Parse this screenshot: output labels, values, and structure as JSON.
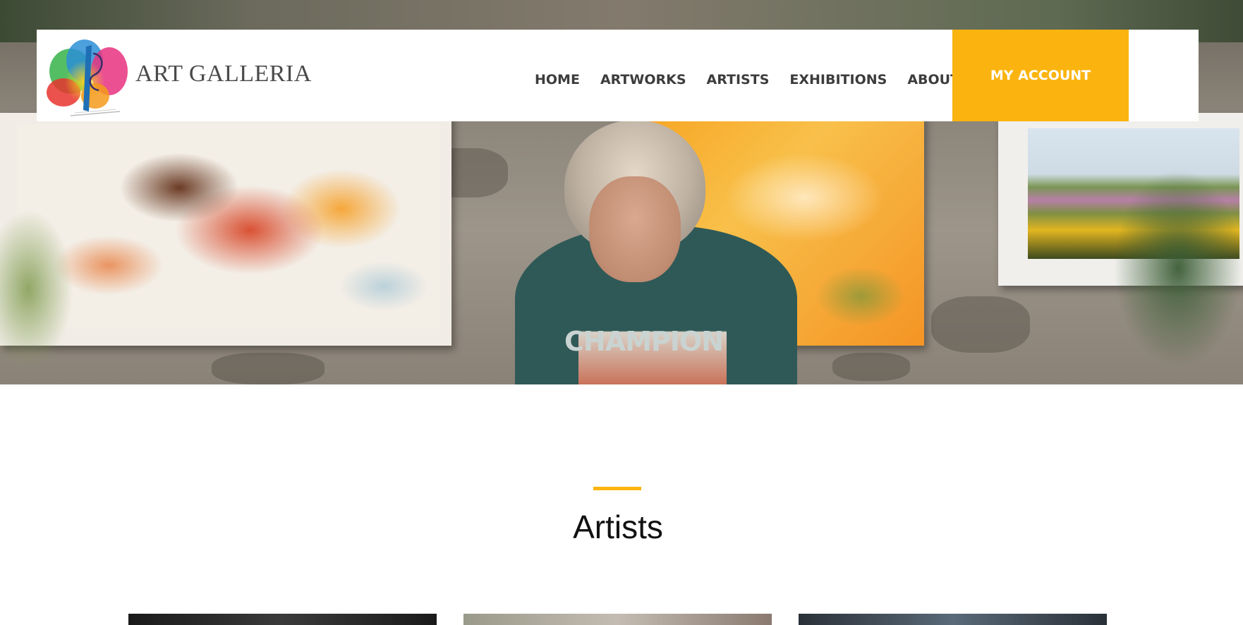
{
  "header": {
    "brand": "ART GALLERIA",
    "nav": [
      {
        "label": "HOME"
      },
      {
        "label": "ARTWORKS"
      },
      {
        "label": "ARTISTS"
      },
      {
        "label": "EXHIBITIONS"
      },
      {
        "label": "ABOUT US"
      }
    ],
    "account_label": "MY ACCOUNT"
  },
  "hero": {
    "shirt_text": "CHAMPION"
  },
  "section": {
    "title": "Artists"
  },
  "colors": {
    "accent": "#fbb40f",
    "text_dark": "#111111",
    "nav_text": "#3c3c3c",
    "background": "#ffffff"
  },
  "icons": [
    "art-galleria-logo"
  ]
}
